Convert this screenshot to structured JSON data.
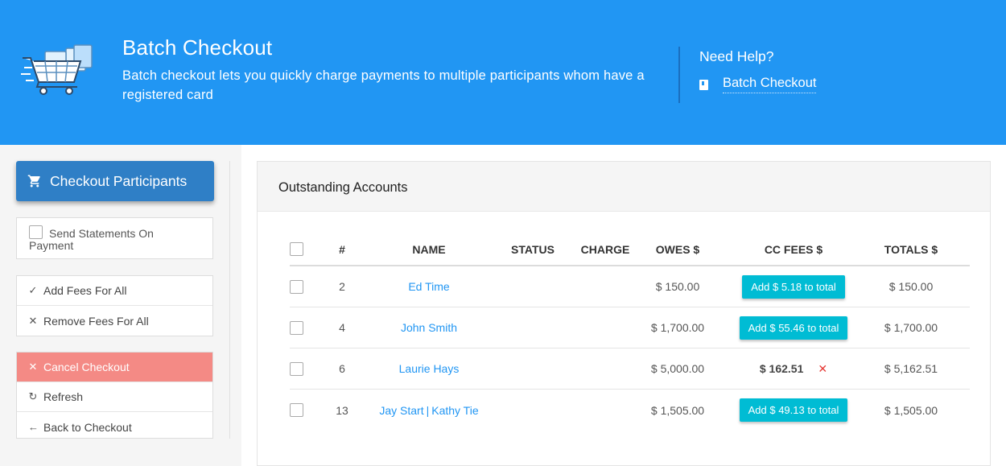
{
  "header": {
    "title": "Batch Checkout",
    "description": "Batch checkout lets you quickly charge payments to multiple participants whom have a registered card",
    "help_title": "Need Help?",
    "help_link": "Batch Checkout",
    "colors": {
      "background": "#2196f3"
    }
  },
  "sidebar": {
    "checkout_button": "Checkout Participants",
    "send_statements": {
      "label_line1": "Send Statements On",
      "label_line2": "Payment",
      "checked": false
    },
    "fee_actions": [
      {
        "label": "Add Fees For All",
        "icon": "check-icon"
      },
      {
        "label": "Remove Fees For All",
        "icon": "close-icon"
      }
    ],
    "nav_actions": [
      {
        "label": "Cancel Checkout",
        "icon": "close-icon"
      },
      {
        "label": "Refresh",
        "icon": "refresh-icon"
      },
      {
        "label": "Back to Checkout",
        "icon": "arrow-left-icon"
      }
    ]
  },
  "panel": {
    "title": "Outstanding Accounts",
    "columns": [
      "#",
      "NAME",
      "STATUS",
      "CHARGE",
      "OWES $",
      "CC FEES $",
      "TOTALS $"
    ],
    "rows": [
      {
        "num": "2",
        "names": [
          "Ed Time"
        ],
        "status": "",
        "charge": "",
        "owes": "$ 150.00",
        "fee_button": "Add $ 5.18 to total",
        "fee_amount": "",
        "total": "$ 150.00"
      },
      {
        "num": "4",
        "names": [
          "John Smith"
        ],
        "status": "",
        "charge": "",
        "owes": "$ 1,700.00",
        "fee_button": "Add $ 55.46 to total",
        "fee_amount": "",
        "total": "$ 1,700.00"
      },
      {
        "num": "6",
        "names": [
          "Laurie Hays"
        ],
        "status": "",
        "charge": "",
        "owes": "$ 5,000.00",
        "fee_button": "",
        "fee_amount": "$ 162.51",
        "total": "$ 5,162.51"
      },
      {
        "num": "13",
        "names": [
          "Jay Start",
          "Kathy Tie"
        ],
        "status": "",
        "charge": "",
        "owes": "$ 1,505.00",
        "fee_button": "Add $ 49.13 to total",
        "fee_amount": "",
        "total": "$ 1,505.00"
      }
    ],
    "colors": {
      "link": "#2196f3",
      "fee_button": "#00bcd4",
      "remove": "#e53935",
      "cancel": "#f48a85"
    }
  }
}
